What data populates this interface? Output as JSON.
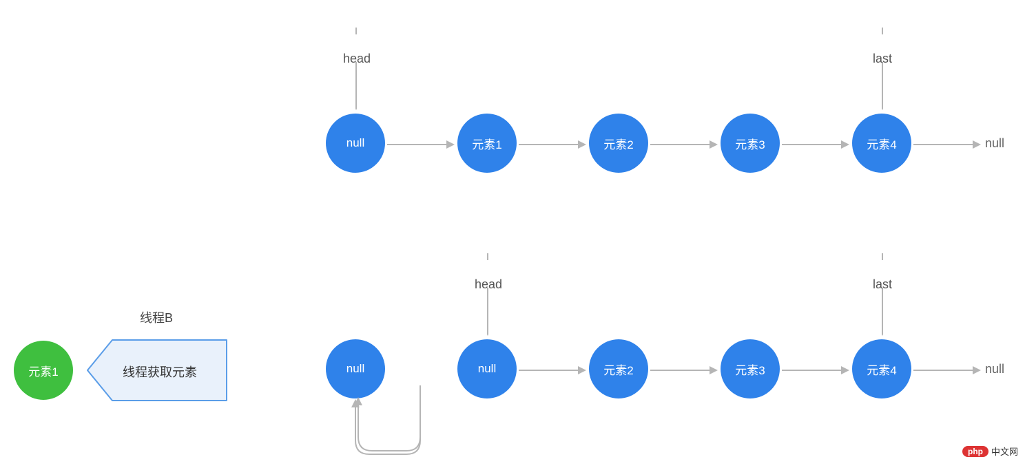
{
  "chart_data": {
    "type": "linked-list-diagram",
    "top_list": {
      "head_ptr": {
        "label": "head",
        "points_to_index": 0
      },
      "last_ptr": {
        "label": "last",
        "points_to_index": 4
      },
      "nodes": [
        "null",
        "元素1",
        "元素2",
        "元素3",
        "元素4"
      ],
      "trailing_null": "null"
    },
    "bottom_list": {
      "head_ptr": {
        "label": "head",
        "points_to_index": 1
      },
      "last_ptr": {
        "label": "last",
        "points_to_index": 4
      },
      "nodes": [
        "null",
        "null",
        "元素2",
        "元素3",
        "元素4"
      ],
      "node_0_self_loop": true,
      "trailing_null": "null"
    },
    "thread": {
      "title": "线程B",
      "action_label": "线程获取元素",
      "retrieved_element": "元素1"
    },
    "watermark": {
      "brand": "php",
      "site": "中文网"
    }
  }
}
